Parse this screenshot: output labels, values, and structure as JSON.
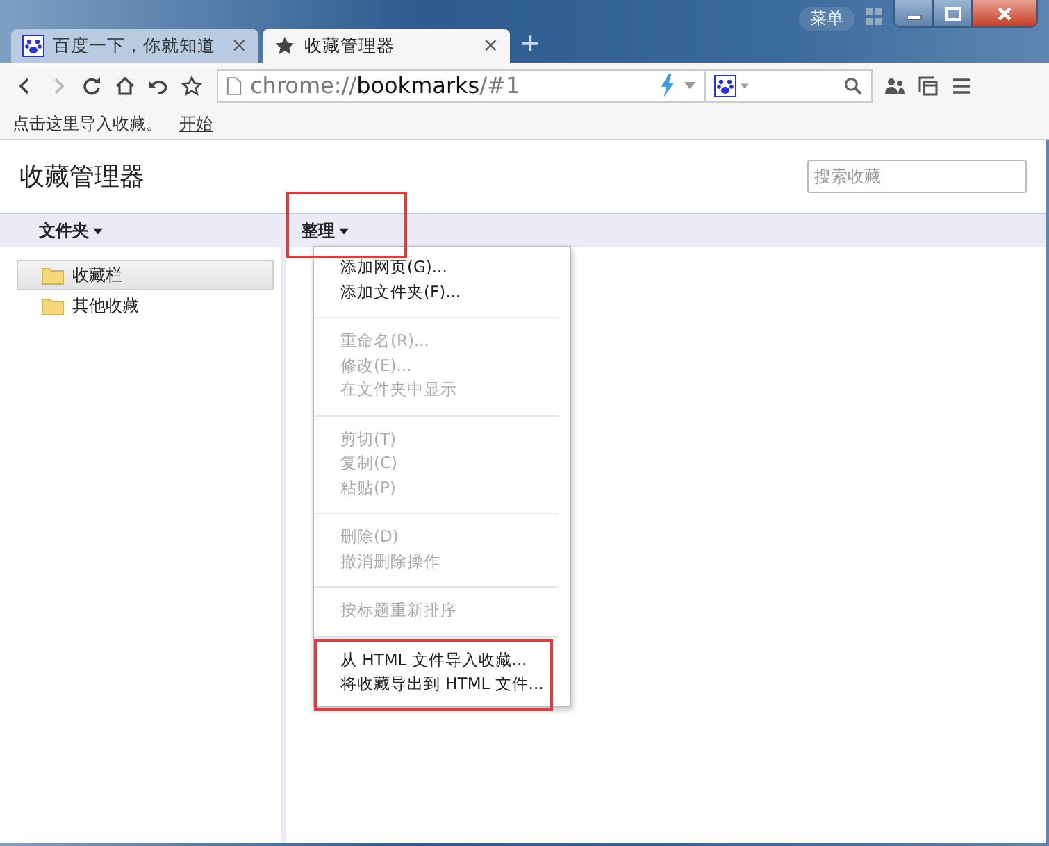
{
  "window": {
    "menu_label": "菜单"
  },
  "tabs": [
    {
      "title": "百度一下，你就知道",
      "close": "×",
      "selected": false
    },
    {
      "title": "收藏管理器",
      "close": "×",
      "selected": true
    }
  ],
  "new_tab": "+",
  "address_bar": {
    "scheme": "chrome://",
    "host": "bookmarks",
    "path": "/#1"
  },
  "bookmarks_bar": [
    {
      "label": "点击这里导入收藏。",
      "kind": "text"
    },
    {
      "label": "开始",
      "kind": "link"
    }
  ],
  "page": {
    "title": "收藏管理器",
    "search": {
      "placeholder": "搜索收藏"
    }
  },
  "toolbar": {
    "folders_label": "文件夹",
    "organize_label": "整理"
  },
  "folders": [
    {
      "label": "收藏栏",
      "selected": true
    },
    {
      "label": "其他收藏",
      "selected": false
    }
  ],
  "menu": {
    "groups": [
      [
        {
          "label": "添加网页(G)...",
          "disabled": false
        },
        {
          "label": "添加文件夹(F)...",
          "disabled": false
        }
      ],
      [
        {
          "label": "重命名(R)...",
          "disabled": true
        },
        {
          "label": "修改(E)...",
          "disabled": true
        },
        {
          "label": "在文件夹中显示",
          "disabled": true
        }
      ],
      [
        {
          "label": "剪切(T)",
          "disabled": true
        },
        {
          "label": "复制(C)",
          "disabled": true
        },
        {
          "label": "粘贴(P)",
          "disabled": true
        }
      ],
      [
        {
          "label": "删除(D)",
          "disabled": true
        },
        {
          "label": "撤消删除操作",
          "disabled": true
        }
      ],
      [
        {
          "label": "按标题重新排序",
          "disabled": true
        }
      ],
      [
        {
          "label": "从 HTML 文件导入收藏...",
          "disabled": false
        },
        {
          "label": "将收藏导出到 HTML 文件...",
          "disabled": false
        }
      ]
    ]
  }
}
